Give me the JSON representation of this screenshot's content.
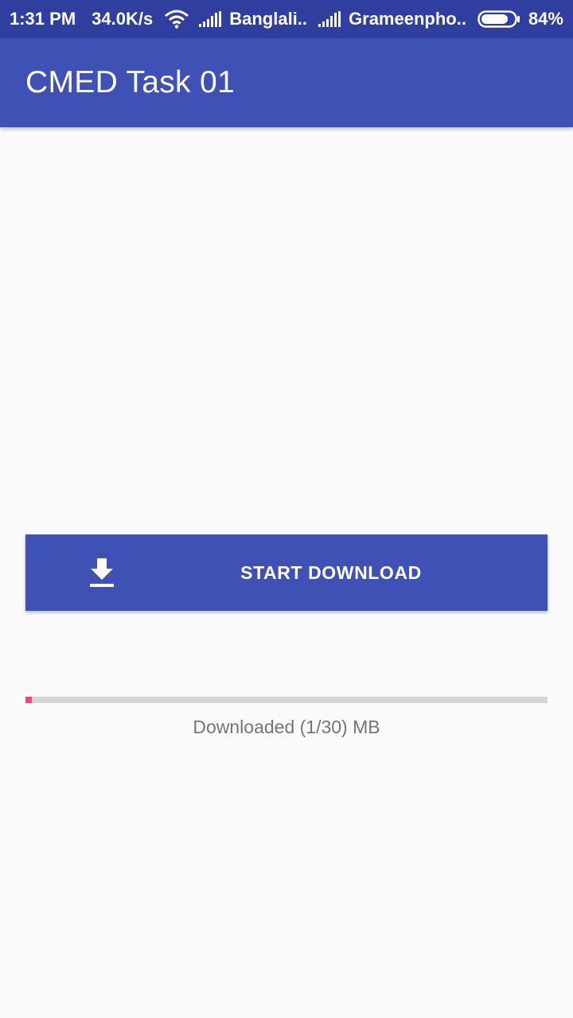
{
  "status_bar": {
    "time": "1:31 PM",
    "net_speed": "34.0K/s",
    "wifi_icon": "wifi-icon",
    "carrier_1": "Banglali..",
    "carrier_2": "Grameenpho..",
    "battery_percent": "84%",
    "battery_level": 0.84,
    "background_color": "#303f9f"
  },
  "app_bar": {
    "title": "CMED Task 01",
    "background_color": "#3f51b5"
  },
  "download_button": {
    "label": "START DOWNLOAD",
    "icon": "download-icon",
    "background_color": "#3f51b5"
  },
  "progress": {
    "downloaded_mb": 1,
    "total_mb": 30,
    "status_text": "Downloaded (1/30) MB",
    "fill_color": "#ff4081",
    "track_color": "#d6d6d6"
  }
}
